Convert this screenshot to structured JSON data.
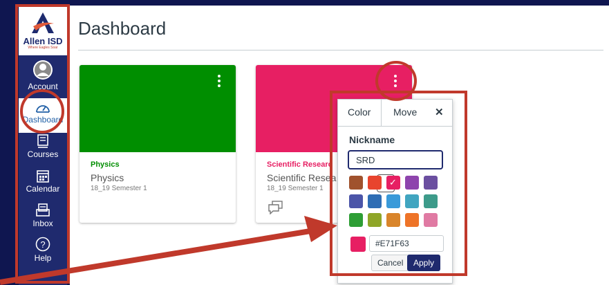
{
  "sidebar": {
    "logo_name": "Allen ISD",
    "logo_tagline": "Where Eagles Soar",
    "items": [
      {
        "label": "Account"
      },
      {
        "label": "Dashboard"
      },
      {
        "label": "Courses"
      },
      {
        "label": "Calendar"
      },
      {
        "label": "Inbox"
      },
      {
        "label": "Help"
      }
    ]
  },
  "main": {
    "title": "Dashboard",
    "cards": [
      {
        "nickname": "Physics",
        "name": "Physics",
        "term": "18_19 Semester 1",
        "color": "#008E00"
      },
      {
        "nickname": "Scientific Researc",
        "name": "Scientific Resea",
        "term": "18_19 Semester 1",
        "color": "#E71F63"
      }
    ]
  },
  "popover": {
    "tab_color": "Color",
    "tab_move": "Move",
    "close_label": "✕",
    "nickname_label": "Nickname",
    "nickname_value": "SRD",
    "hex_value": "#E71F63",
    "cancel_label": "Cancel",
    "apply_label": "Apply",
    "swatches": [
      "#A0522D",
      "#E8442E",
      "#E71F63",
      "#8E44AD",
      "#6B4FA0",
      "#4B55A8",
      "#2E6DB4",
      "#3A9AD9",
      "#41A5C0",
      "#3D9B8A",
      "#2E9E35",
      "#8FA628",
      "#D9852B",
      "#EE7428",
      "#E07AA3"
    ],
    "selected_swatch": "#E71F63"
  },
  "annotation_color": "#C0392B"
}
